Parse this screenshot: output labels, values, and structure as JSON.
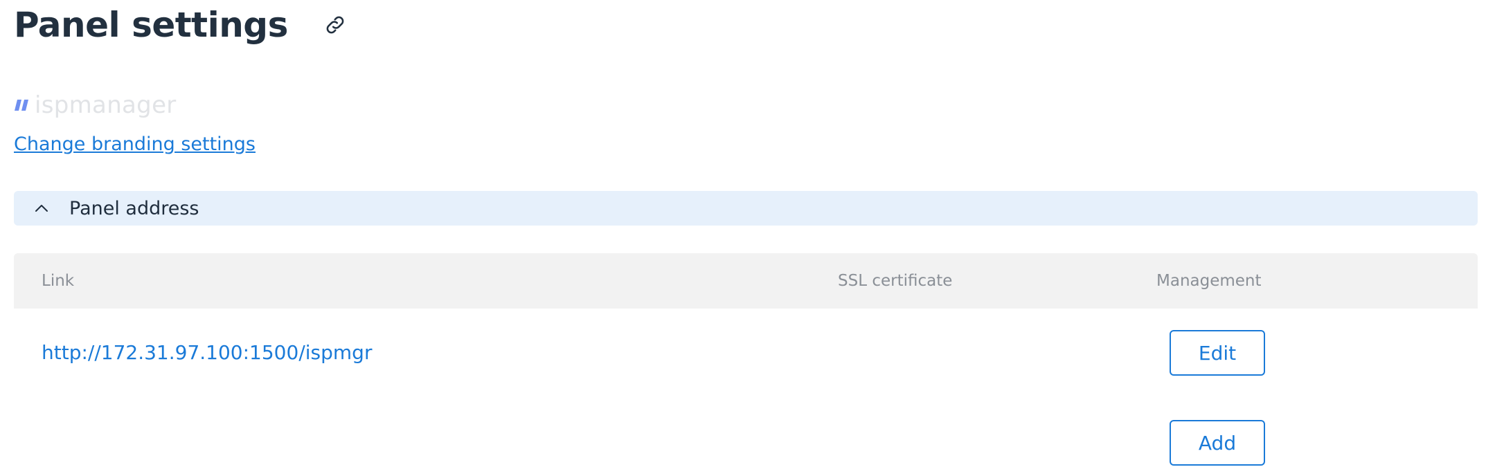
{
  "page": {
    "title": "Panel settings",
    "copy_link_icon": "link-icon"
  },
  "branding": {
    "logo_text": "ispmanager",
    "logo_mark_color": "#6f8ff0",
    "logo_text_color": "#e1e3e6",
    "change_link_label": "Change branding settings"
  },
  "section": {
    "title": "Panel address",
    "expanded": true,
    "toggle_icon": "chevron-up-icon"
  },
  "table": {
    "columns": [
      "Link",
      "SSL certificate",
      "Management"
    ],
    "rows": [
      {
        "link": "http://172.31.97.100:1500/ispmgr",
        "ssl_certificate": "",
        "action_label": "Edit"
      }
    ],
    "add_label": "Add"
  },
  "colors": {
    "accent": "#1a7ad8",
    "section_bg": "#e6f0fb",
    "header_bg": "#f2f2f2",
    "title_text": "#22303f"
  }
}
